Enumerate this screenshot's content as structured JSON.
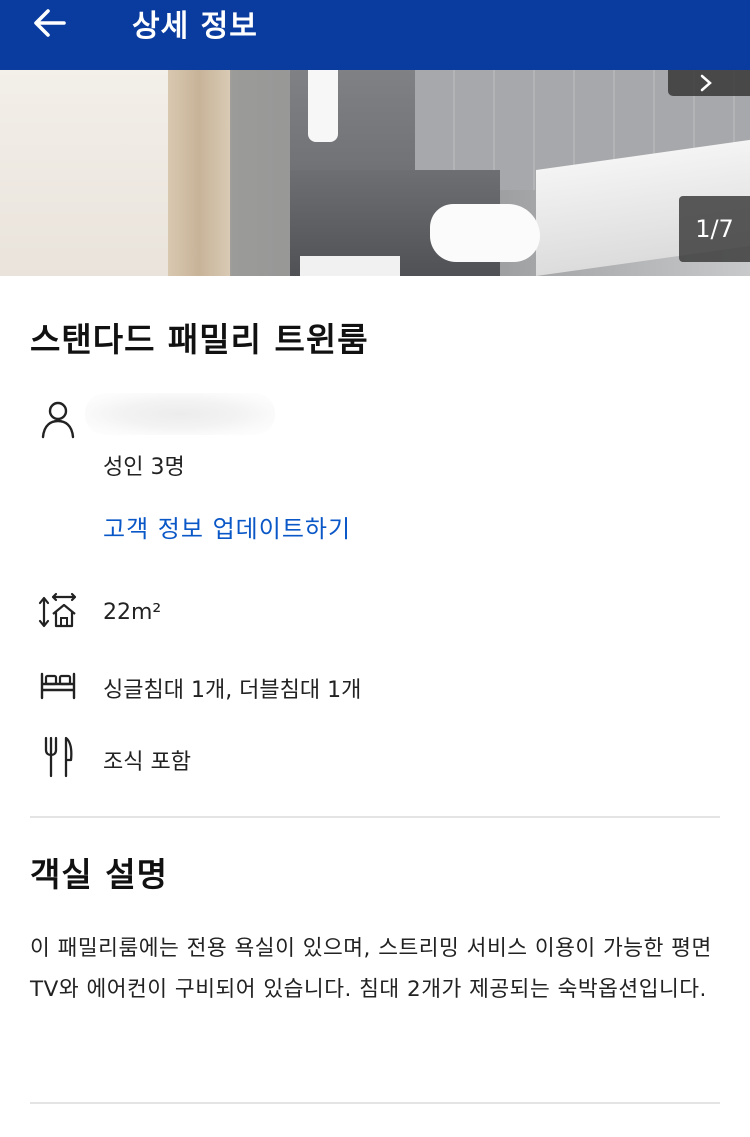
{
  "header": {
    "back_icon": "arrow-left-icon",
    "title": "상세 정보",
    "background_color": "#0a3b9e"
  },
  "gallery": {
    "counter": "1/7",
    "next_icon": "chevron-right-icon"
  },
  "room": {
    "name": "스탠다드 패밀리 트윈룸",
    "guests": "성인 3명",
    "update_link": "고객 정보 업데이트하기",
    "size": "22m²",
    "beds": "싱글침대 1개, 더블침대 1개",
    "meal": "조식 포함"
  },
  "description": {
    "title": "객실 설명",
    "text": "이 패밀리룸에는 전용 욕실이 있으며, 스트리밍 서비스 이용이 가능한 평면 TV와 에어컨이 구비되어 있습니다. 침대 2개가 제공되는 숙박옵션입니다."
  },
  "colors": {
    "accent": "#0a3b9e",
    "link": "#0a57c7"
  }
}
